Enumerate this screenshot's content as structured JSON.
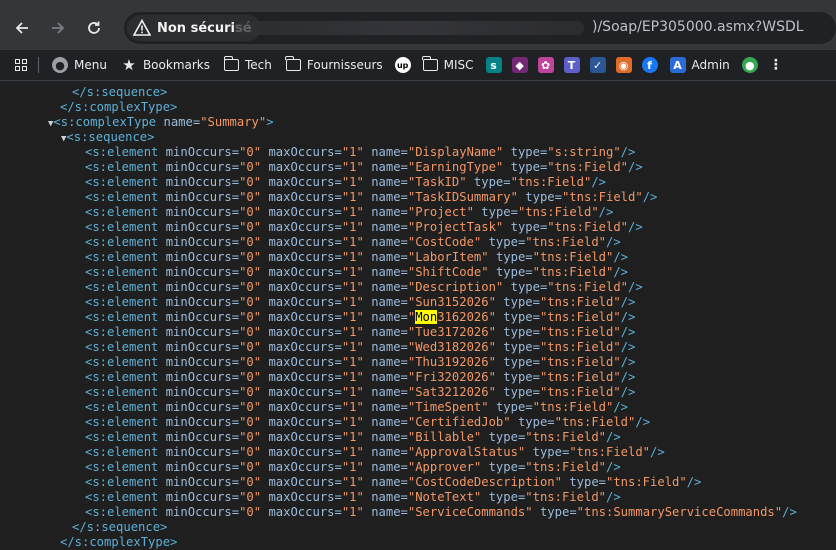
{
  "browser": {
    "security_label": "Non sécurisé",
    "url_visible": ")/Soap/EP305000.asmx?WSDL",
    "bookmarks": [
      {
        "label": "",
        "icon": "apps-grid-icon"
      },
      {
        "label": "Menu",
        "icon": "globe-icon"
      },
      {
        "label": "Bookmarks",
        "icon": "star-icon"
      },
      {
        "label": "Tech",
        "icon": "folder-icon"
      },
      {
        "label": "Fournisseurs",
        "icon": "folder-icon"
      },
      {
        "label": "",
        "icon": "up-logo-icon"
      },
      {
        "label": "MISC",
        "icon": "folder-icon"
      },
      {
        "label": "",
        "icon": "sharepoint-icon"
      },
      {
        "label": "",
        "icon": "power-apps-icon"
      },
      {
        "label": "",
        "icon": "copilot-icon"
      },
      {
        "label": "",
        "icon": "teams-icon"
      },
      {
        "label": "",
        "icon": "checkmark-app-icon"
      },
      {
        "label": "",
        "icon": "photos-icon"
      },
      {
        "label": "",
        "icon": "facebook-icon"
      },
      {
        "label": "Admin",
        "icon": "admin-app-icon"
      },
      {
        "label": "",
        "icon": "maps-pin-icon"
      },
      {
        "label": "",
        "icon": "more-icon"
      }
    ]
  },
  "xml": {
    "seq_close": "</s:sequence>",
    "ct_close": "</s:complexType>",
    "ct_open": "<s:complexType",
    "ct_name_attr": "name=",
    "ct_name_value": "\"Summary\"",
    "ct_gt": ">",
    "seq_open": "<s:sequence>",
    "el_open": "<s:element",
    "min_attr": "minOccurs=",
    "min_val": "\"0\"",
    "max_attr": "maxOccurs=",
    "max_val": "\"1\"",
    "name_attr": "name=",
    "type_attr": "type=",
    "self_close": "/>",
    "highlight": "Mon",
    "elements": [
      {
        "name": "DisplayName",
        "type": "s:string"
      },
      {
        "name": "EarningType",
        "type": "tns:Field"
      },
      {
        "name": "TaskID",
        "type": "tns:Field"
      },
      {
        "name": "TaskIDSummary",
        "type": "tns:Field"
      },
      {
        "name": "Project",
        "type": "tns:Field"
      },
      {
        "name": "ProjectTask",
        "type": "tns:Field"
      },
      {
        "name": "CostCode",
        "type": "tns:Field"
      },
      {
        "name": "LaborItem",
        "type": "tns:Field"
      },
      {
        "name": "ShiftCode",
        "type": "tns:Field"
      },
      {
        "name": "Description",
        "type": "tns:Field"
      },
      {
        "name": "Sun3152026",
        "type": "tns:Field"
      },
      {
        "name": "Mon3162026",
        "type": "tns:Field"
      },
      {
        "name": "Tue3172026",
        "type": "tns:Field"
      },
      {
        "name": "Wed3182026",
        "type": "tns:Field"
      },
      {
        "name": "Thu3192026",
        "type": "tns:Field"
      },
      {
        "name": "Fri3202026",
        "type": "tns:Field"
      },
      {
        "name": "Sat3212026",
        "type": "tns:Field"
      },
      {
        "name": "TimeSpent",
        "type": "tns:Field"
      },
      {
        "name": "CertifiedJob",
        "type": "tns:Field"
      },
      {
        "name": "Billable",
        "type": "tns:Field"
      },
      {
        "name": "ApprovalStatus",
        "type": "tns:Field"
      },
      {
        "name": "Approver",
        "type": "tns:Field"
      },
      {
        "name": "CostCodeDescription",
        "type": "tns:Field"
      },
      {
        "name": "NoteText",
        "type": "tns:Field"
      },
      {
        "name": "ServiceCommands",
        "type": "tns:SummaryServiceCommands"
      }
    ]
  }
}
